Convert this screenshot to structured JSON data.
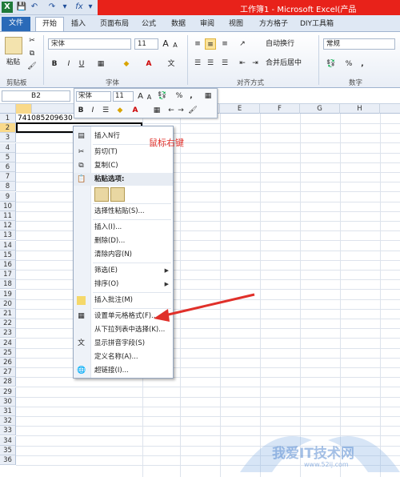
{
  "window": {
    "title": "工作簿1 - Microsoft Excel(产品"
  },
  "quick_access": [
    "X",
    "💾",
    "↶",
    "↷",
    "▾",
    "fx",
    "▾"
  ],
  "tabs": [
    "文件",
    "开始",
    "插入",
    "页面布局",
    "公式",
    "数据",
    "审阅",
    "视图",
    "方方格子",
    "DIY工具箱"
  ],
  "ribbon": {
    "paste_label": "粘贴",
    "font_name": "宋体",
    "font_size": "11",
    "font_grow": "A",
    "font_shrink": "A",
    "bold": "B",
    "italic": "I",
    "underline": "U",
    "wrap_text": "自动换行",
    "merge_center": "合并后居中",
    "number_format": "常规",
    "percent": "%",
    "comma": ",",
    "groups": {
      "clipboard": "剪贴板",
      "font": "字体",
      "alignment": "对齐方式",
      "number": "数字"
    }
  },
  "formula_bar": {
    "name_box": "B2"
  },
  "columns": [
    "B",
    "C",
    "D",
    "E",
    "F",
    "G",
    "H"
  ],
  "rows": [
    "1",
    "2",
    "3",
    "4",
    "5",
    "6",
    "7",
    "8",
    "9",
    "10",
    "11",
    "12",
    "13",
    "14",
    "15",
    "16",
    "17",
    "18",
    "19",
    "20",
    "21",
    "22",
    "23",
    "24",
    "25",
    "26",
    "27",
    "28",
    "29",
    "30",
    "31",
    "32",
    "33",
    "34",
    "35",
    "36"
  ],
  "cells": {
    "A1": "741085209630"
  },
  "mini_toolbar": {
    "font_name": "宋体",
    "font_size": "11",
    "grow": "A",
    "shrink": "A",
    "percent": "%",
    "comma": ",",
    "bold": "B",
    "italic": "I",
    "font_color": "A"
  },
  "context_menu": {
    "items": [
      {
        "label": "插入N行",
        "icon": "insert-rows-icon"
      },
      {
        "label": "剪切(T)",
        "icon": "scissors-icon"
      },
      {
        "label": "复制(C)",
        "icon": "copy-icon"
      },
      {
        "label": "粘贴选项:",
        "icon": "clipboard-icon"
      },
      {
        "label": "选择性粘贴(S)...",
        "icon": ""
      },
      {
        "label": "插入(I)...",
        "icon": ""
      },
      {
        "label": "删除(D)...",
        "icon": ""
      },
      {
        "label": "清除内容(N)",
        "icon": ""
      },
      {
        "label": "筛选(E)",
        "icon": ""
      },
      {
        "label": "排序(O)",
        "icon": ""
      },
      {
        "label": "插入批注(M)",
        "icon": "comment-icon"
      },
      {
        "label": "设置单元格格式(F)...",
        "icon": "format-cells-icon"
      },
      {
        "label": "从下拉列表中选择(K)...",
        "icon": ""
      },
      {
        "label": "显示拼音字段(S)",
        "icon": "phonetic-icon"
      },
      {
        "label": "定义名称(A)...",
        "icon": ""
      },
      {
        "label": "超链接(I)...",
        "icon": "hyperlink-icon"
      }
    ]
  },
  "annotation": "鼠标右键",
  "watermark": {
    "text": "我爱IT技术网",
    "url": "www.52ij.com"
  }
}
